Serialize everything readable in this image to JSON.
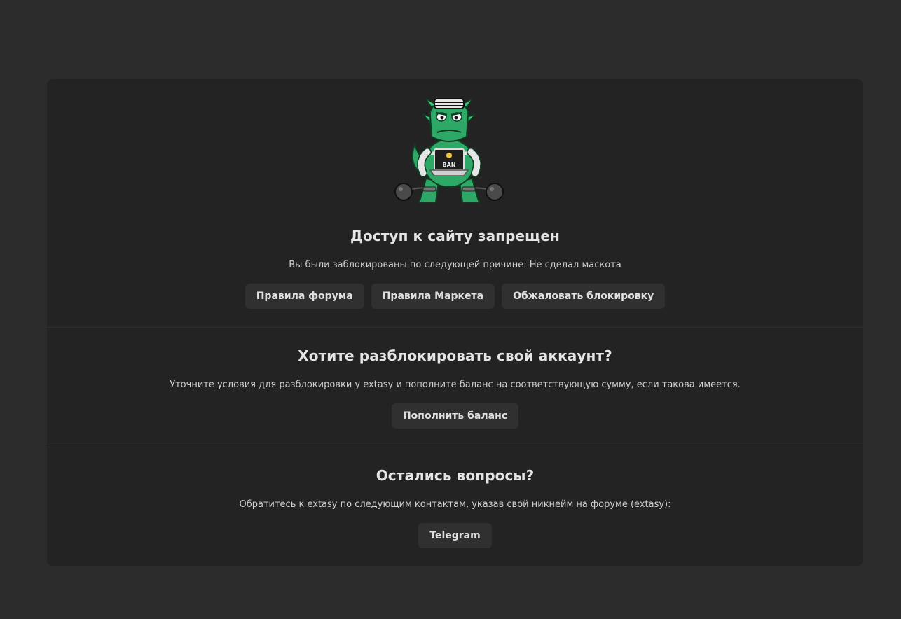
{
  "ban": {
    "title": "Доступ к сайту запрещен",
    "reason": "Вы были заблокированы по следующей причине: Не сделал маскота",
    "mascot_text": "BAN",
    "buttons": {
      "forum_rules": "Правила форума",
      "market_rules": "Правила Маркета",
      "appeal": "Обжаловать блокировку"
    }
  },
  "unban": {
    "title": "Хотите разблокировать свой аккаунт?",
    "description": "Уточните условия для разблокировки у extasy и пополните баланс на соответствующую сумму, если такова имеется.",
    "button": "Пополнить баланс"
  },
  "questions": {
    "title": "Остались вопросы?",
    "description": "Обратитесь к extasy по следующим контактам, указав свой никнейм на форуме (extasy):",
    "button": "Telegram"
  },
  "colors": {
    "page_bg": "#2c2c2c",
    "card_bg": "#232323",
    "button_bg": "#303030",
    "mascot_green": "#2ea866"
  }
}
